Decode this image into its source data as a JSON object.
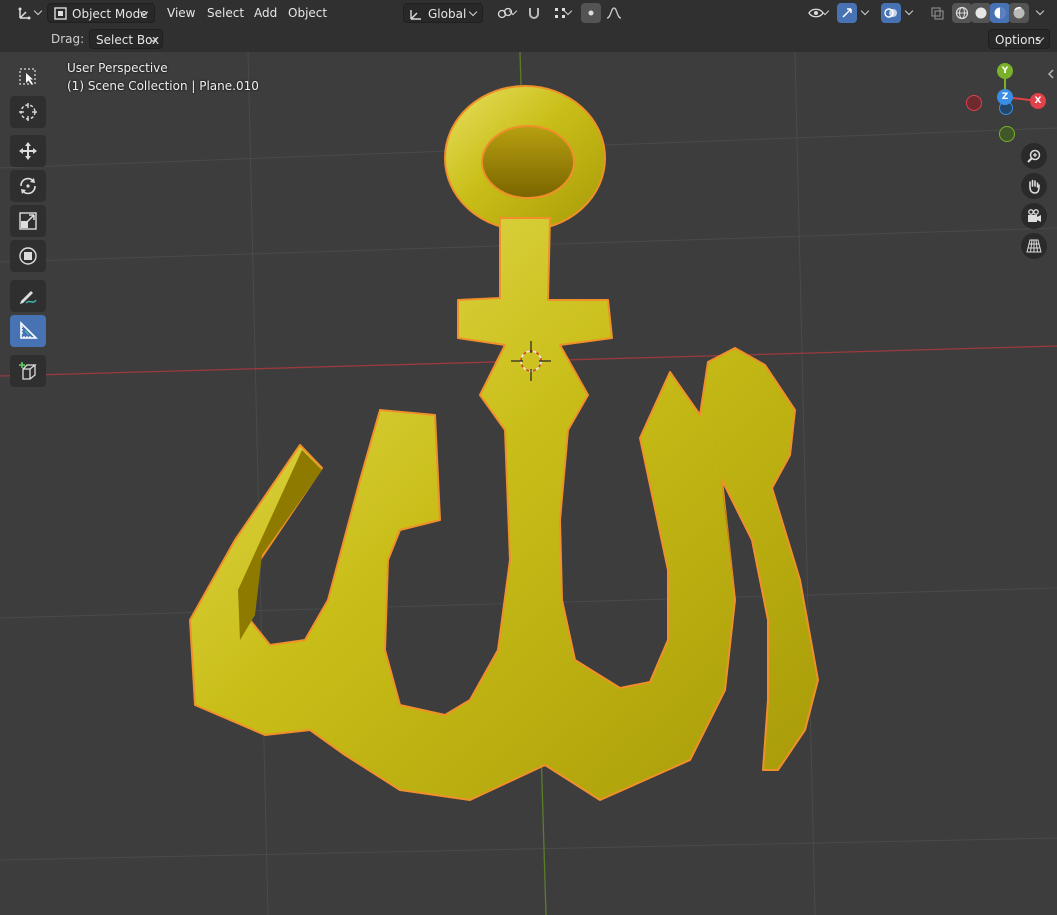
{
  "header": {
    "mode_label": "Object Mode",
    "menus": [
      "View",
      "Select",
      "Add",
      "Object"
    ],
    "orientation_label": "Global"
  },
  "tool_options": {
    "drag_label": "Drag:",
    "drag_value": "Select Box",
    "options_label": "Options"
  },
  "viewport": {
    "perspective_label": "User Perspective",
    "collection_label": "(1) Scene Collection | Plane.010"
  },
  "gizmo": {
    "x": "X",
    "y": "Y",
    "z": "Z"
  },
  "toolbar": {
    "tools": [
      "select-box",
      "cursor",
      "move",
      "rotate",
      "scale",
      "transform",
      "annotate",
      "measure",
      "add-cube"
    ],
    "active_tool": "measure"
  },
  "colors": {
    "header_bg": "#303030",
    "viewport_bg": "#3d3d3d",
    "active_blue": "#4772b3",
    "axis_x": "#e0414a",
    "axis_y": "#7bb02a",
    "axis_z": "#3a8ee6",
    "object_gold": "#c8bf1a",
    "selection_outline": "#f0902a"
  }
}
